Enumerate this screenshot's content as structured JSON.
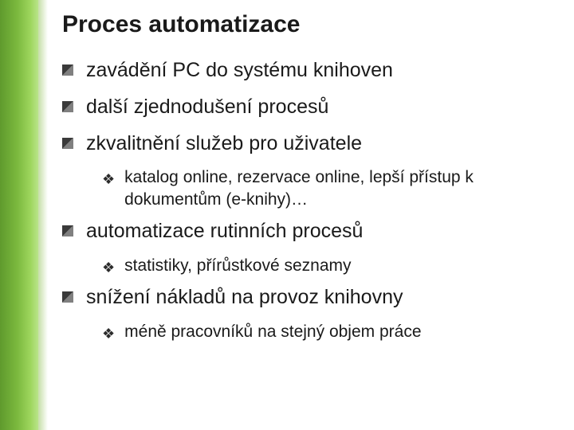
{
  "slide": {
    "title": "Proces automatizace",
    "items": [
      {
        "text": "zavádění PC do systému knihoven",
        "subs": []
      },
      {
        "text": "další zjednodušení procesů",
        "subs": []
      },
      {
        "text": "zkvalitnění služeb pro uživatele",
        "subs": [
          "katalog online, rezervace online, lepší přístup k dokumentům (e-knihy)…"
        ]
      },
      {
        "text": "automatizace rutinních procesů",
        "subs": [
          "statistiky, přírůstkové seznamy"
        ]
      },
      {
        "text": "snížení nákladů na provoz knihovny",
        "subs": [
          "méně pracovníků na stejný objem práce"
        ]
      }
    ]
  }
}
